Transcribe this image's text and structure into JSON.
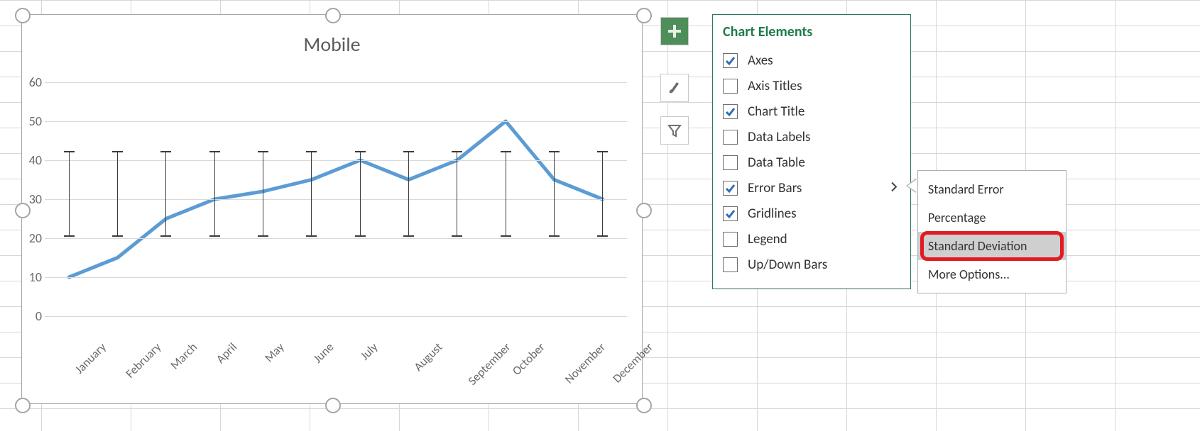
{
  "chart_data": {
    "type": "line",
    "title": "Mobile",
    "xlabel": "",
    "ylabel": "",
    "ylim": [
      0,
      60
    ],
    "yticks": [
      0,
      10,
      20,
      30,
      40,
      50,
      60
    ],
    "categories": [
      "January",
      "February",
      "March",
      "April",
      "May",
      "June",
      "July",
      "August",
      "September",
      "October",
      "November",
      "December"
    ],
    "values": [
      10,
      15,
      25,
      30,
      32,
      35,
      40,
      35,
      40,
      50,
      35,
      30
    ],
    "error_bars": {
      "mode": "standard_deviation",
      "center": 31.4,
      "low": 20.6,
      "high": 42.2
    }
  },
  "panel": {
    "title": "Chart Elements",
    "options": [
      {
        "label": "Axes",
        "checked": true
      },
      {
        "label": "Axis Titles",
        "checked": false
      },
      {
        "label": "Chart Title",
        "checked": true
      },
      {
        "label": "Data Labels",
        "checked": false
      },
      {
        "label": "Data Table",
        "checked": false
      },
      {
        "label": "Error Bars",
        "checked": true,
        "hasSub": true
      },
      {
        "label": "Gridlines",
        "checked": true
      },
      {
        "label": "Legend",
        "checked": false
      },
      {
        "label": "Up/Down Bars",
        "checked": false
      }
    ]
  },
  "submenu": {
    "items": [
      "Standard Error",
      "Percentage",
      "Standard Deviation",
      "More Options..."
    ],
    "highlighted": "Standard Deviation"
  },
  "flyout_buttons": [
    "plus",
    "brush",
    "filter"
  ]
}
